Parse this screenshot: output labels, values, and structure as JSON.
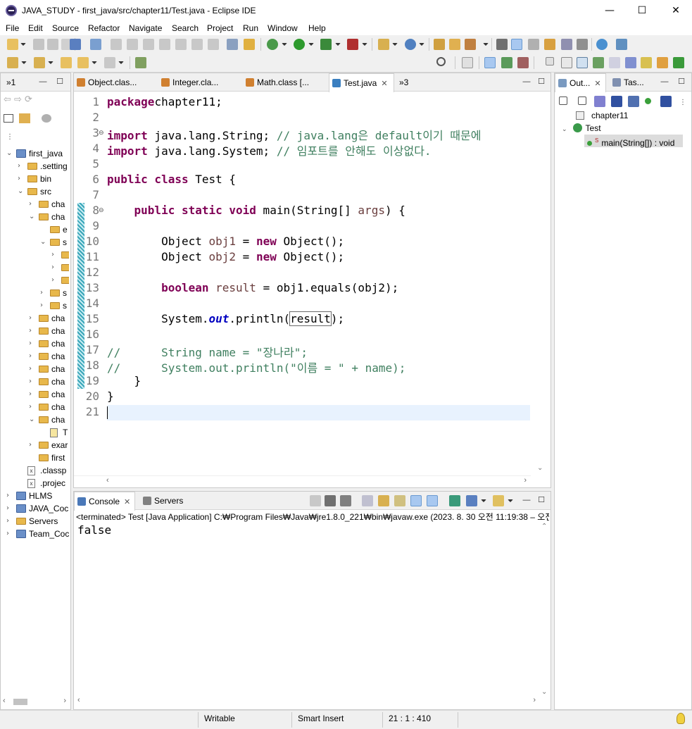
{
  "window": {
    "title": "JAVA_STUDY - first_java/src/chapter11/Test.java - Eclipse IDE",
    "minimize": "—",
    "maximize": "☐",
    "close": "✕"
  },
  "menu": [
    "File",
    "Edit",
    "Source",
    "Refactor",
    "Navigate",
    "Search",
    "Project",
    "Run",
    "Window",
    "Help"
  ],
  "package_explorer": {
    "tab_label": "»1",
    "items": [
      {
        "label": "first_java",
        "kind": "project",
        "twisty": "open"
      },
      {
        "label": ".setting",
        "kind": "folder",
        "twisty": "closed"
      },
      {
        "label": "bin",
        "kind": "folder",
        "twisty": "closed"
      },
      {
        "label": "src",
        "kind": "folder",
        "twisty": "open"
      },
      {
        "label": "cha",
        "kind": "folder",
        "twisty": "closed"
      },
      {
        "label": "cha",
        "kind": "folder",
        "twisty": "open"
      },
      {
        "label": "e",
        "kind": "folder",
        "twisty": "none"
      },
      {
        "label": "s",
        "kind": "folder",
        "twisty": "open"
      },
      {
        "label": "",
        "kind": "folder",
        "twisty": "closed"
      },
      {
        "label": "",
        "kind": "folder",
        "twisty": "closed"
      },
      {
        "label": "",
        "kind": "folder",
        "twisty": "closed"
      },
      {
        "label": "s",
        "kind": "folder",
        "twisty": "closed"
      },
      {
        "label": "s",
        "kind": "folder",
        "twisty": "closed"
      },
      {
        "label": "cha",
        "kind": "folder",
        "twisty": "closed"
      },
      {
        "label": "cha",
        "kind": "folder",
        "twisty": "closed"
      },
      {
        "label": "cha",
        "kind": "folder",
        "twisty": "closed"
      },
      {
        "label": "cha",
        "kind": "folder",
        "twisty": "closed"
      },
      {
        "label": "cha",
        "kind": "folder",
        "twisty": "closed"
      },
      {
        "label": "cha",
        "kind": "folder",
        "twisty": "closed"
      },
      {
        "label": "cha",
        "kind": "folder",
        "twisty": "closed"
      },
      {
        "label": "cha",
        "kind": "folder",
        "twisty": "closed"
      },
      {
        "label": "cha",
        "kind": "folder",
        "twisty": "open"
      },
      {
        "label": "T",
        "kind": "javafile",
        "twisty": "none"
      },
      {
        "label": "exar",
        "kind": "folder",
        "twisty": "closed"
      },
      {
        "label": "first",
        "kind": "folder",
        "twisty": "none"
      },
      {
        "label": ".classp",
        "kind": "xml",
        "twisty": "none"
      },
      {
        "label": ".projec",
        "kind": "xml",
        "twisty": "none"
      },
      {
        "label": "HLMS",
        "kind": "project",
        "twisty": "closed"
      },
      {
        "label": "JAVA_Coc",
        "kind": "project",
        "twisty": "closed"
      },
      {
        "label": "Servers",
        "kind": "folder",
        "twisty": "closed"
      },
      {
        "label": "Team_Coc",
        "kind": "project",
        "twisty": "closed"
      }
    ]
  },
  "editor": {
    "tabs": [
      {
        "label": "Object.clas...",
        "active": false
      },
      {
        "label": "Integer.cla...",
        "active": false
      },
      {
        "label": "Math.class [...",
        "active": false
      },
      {
        "label": "Test.java",
        "active": true
      }
    ],
    "overflow_label": "»3",
    "lines": [
      {
        "n": "1",
        "tokens": [
          [
            "kw",
            "package"
          ],
          [
            "",
            "chapter11;"
          ]
        ]
      },
      {
        "n": "2",
        "tokens": []
      },
      {
        "n": "3",
        "tokens": [
          [
            "kw",
            "import"
          ],
          [
            "",
            " java.lang.String; "
          ],
          [
            "cm",
            "// java.lang은 default이기 때문에"
          ]
        ]
      },
      {
        "n": "4",
        "tokens": [
          [
            "kw",
            "import"
          ],
          [
            "",
            " java.lang.System; "
          ],
          [
            "cm",
            "// 임포트를 안해도 이상없다."
          ]
        ]
      },
      {
        "n": "5",
        "tokens": []
      },
      {
        "n": "6",
        "tokens": [
          [
            "kw",
            "public class"
          ],
          [
            "",
            " Test {"
          ]
        ]
      },
      {
        "n": "7",
        "tokens": []
      },
      {
        "n": "8",
        "tokens": [
          [
            "",
            "    "
          ],
          [
            "kw",
            "public static void"
          ],
          [
            "",
            " main(String[] "
          ],
          [
            "lv",
            "args"
          ],
          [
            "",
            ") {"
          ]
        ]
      },
      {
        "n": "9",
        "tokens": []
      },
      {
        "n": "10",
        "tokens": [
          [
            "",
            "        Object "
          ],
          [
            "lv",
            "obj1"
          ],
          [
            "",
            " = "
          ],
          [
            "kw",
            "new"
          ],
          [
            "",
            " Object();"
          ]
        ]
      },
      {
        "n": "11",
        "tokens": [
          [
            "",
            "        Object "
          ],
          [
            "lv",
            "obj2"
          ],
          [
            "",
            " = "
          ],
          [
            "kw",
            "new"
          ],
          [
            "",
            " Object();"
          ]
        ]
      },
      {
        "n": "12",
        "tokens": []
      },
      {
        "n": "13",
        "tokens": [
          [
            "",
            "        "
          ],
          [
            "kw",
            "boolean"
          ],
          [
            "",
            " "
          ],
          [
            "lv",
            "result"
          ],
          [
            "",
            " = obj1.equals(obj2);"
          ]
        ]
      },
      {
        "n": "14",
        "tokens": []
      },
      {
        "n": "15",
        "tokens": [
          [
            "",
            "        System."
          ],
          [
            "sf",
            "out"
          ],
          [
            "",
            ".println("
          ],
          [
            "hl",
            "result"
          ],
          [
            "",
            ");"
          ]
        ]
      },
      {
        "n": "16",
        "tokens": []
      },
      {
        "n": "17",
        "tokens": [
          [
            "cm",
            "//      String name = \"장나라\";"
          ]
        ]
      },
      {
        "n": "18",
        "tokens": [
          [
            "cm",
            "//      System.out.println(\"이름 = \" + name);"
          ]
        ]
      },
      {
        "n": "19",
        "tokens": [
          [
            "",
            "    }"
          ]
        ]
      },
      {
        "n": "20",
        "tokens": [
          [
            "",
            "}"
          ]
        ]
      },
      {
        "n": "21",
        "tokens": []
      }
    ]
  },
  "console": {
    "tabs": [
      {
        "label": "Console",
        "active": true
      },
      {
        "label": "Servers",
        "active": false
      }
    ],
    "terminated_line": "<terminated> Test [Java Application] C:₩Program Files₩Java₩jre1.8.0_221₩bin₩javaw.exe  (2023. 8. 30 오전 11:19:38 – 오전",
    "output": "false"
  },
  "outline": {
    "tabs": [
      {
        "label": "Out...",
        "active": true
      },
      {
        "label": "Tas...",
        "active": false
      }
    ],
    "items": [
      {
        "label": "chapter11",
        "depth": 0
      },
      {
        "label": "Test",
        "depth": 0
      },
      {
        "label": "main(String[]) : void",
        "depth": 1,
        "superscript": "S"
      }
    ]
  },
  "status": {
    "writable": "Writable",
    "insert_mode": "Smart Insert",
    "position": "21 : 1 : 410"
  }
}
